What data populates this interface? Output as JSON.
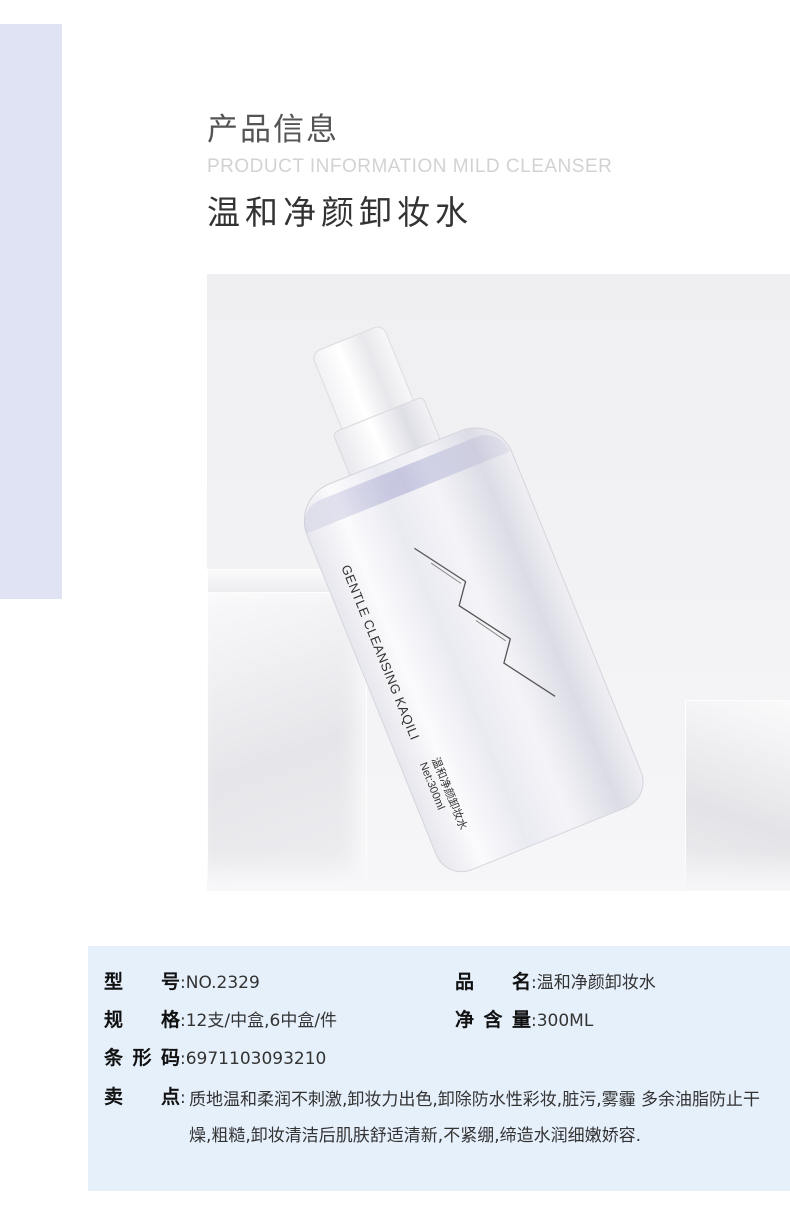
{
  "header": {
    "title_cn": "产品信息",
    "title_en": "PRODUCT INFORMATION  MILD CLEANSER",
    "product_name": "温和净颜卸妆水"
  },
  "bottle": {
    "brand_text": "GENTLE CLEANSING KAQILI",
    "label_cn": "温和净颜卸妆水",
    "net": "Net:300ml"
  },
  "info": {
    "model_label": "型 号",
    "model_value": "NO.2329",
    "name_label": "品 名",
    "name_value": "温和净颜卸妆水",
    "spec_label": "规 格",
    "spec_value": "12支/中盒,6中盒/件",
    "net_label": "净含量",
    "net_value": "300ML",
    "barcode_label": "条形码",
    "barcode_value": "6971103093210",
    "selling_label": "卖 点",
    "selling_value": "质地温和柔润不刺激,卸妆力出色,卸除防水性彩妆,脏污,雾霾 多余油脂防止干燥,粗糙,卸妆清洁后肌肤舒适清新,不紧绷,缔造水润细嫩娇容."
  },
  "colors": {
    "side_block": "#dfe3f4",
    "info_panel": "#e6f0fb"
  }
}
